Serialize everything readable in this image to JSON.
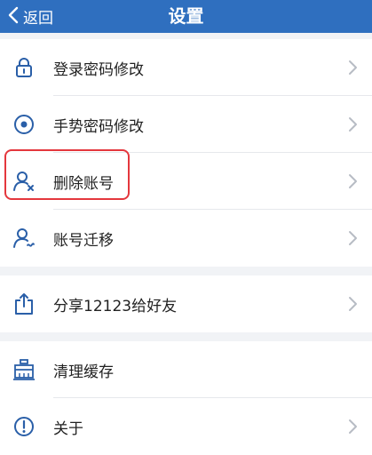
{
  "nav": {
    "back_label": "返回",
    "title": "设置"
  },
  "groups": [
    {
      "items": [
        {
          "label": "登录密码修改",
          "icon": "lock-icon"
        },
        {
          "label": "手势密码修改",
          "icon": "gesture-icon"
        },
        {
          "label": "删除账号",
          "icon": "delete-user-icon"
        },
        {
          "label": "账号迁移",
          "icon": "migrate-user-icon"
        }
      ]
    },
    {
      "items": [
        {
          "label": "分享12123给好友",
          "icon": "share-icon"
        }
      ]
    },
    {
      "items": [
        {
          "label": "清理缓存",
          "icon": "clear-cache-icon"
        },
        {
          "label": "关于",
          "icon": "info-icon"
        }
      ]
    }
  ],
  "colors": {
    "nav_bg": "#2f6fbf",
    "icon": "#2a5fa8",
    "highlight": "#e4373d"
  }
}
